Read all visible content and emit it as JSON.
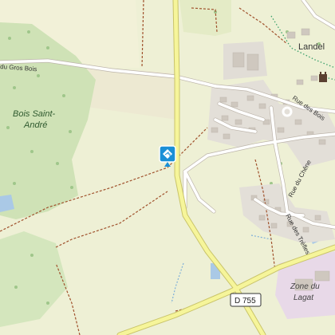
{
  "map": {
    "place_labels": {
      "wood": [
        "Bois Saint-",
        "André"
      ],
      "town": "Landel",
      "zone": [
        "Zone du",
        "Lagat"
      ]
    },
    "street_labels": {
      "gros_bois": "du Gros Bois",
      "rue_des_bois": "Rue des Bois",
      "rue_du_chene": "Rue du Chêne",
      "rue_des_trefles": "Rue des Trèfles"
    },
    "road_shield": "D 755",
    "marker": {
      "icon": "direction-diamond-icon",
      "color": "#1a8fd6"
    },
    "colors": {
      "background": "#eef0d5",
      "forest": "#cfe2b6",
      "forest_dark": "#bcd8a3",
      "main_road": "#f6f59a",
      "road_border": "#c9c46a",
      "minor_road": "#ffffff",
      "building": "#d9d4cd",
      "path": "#a0522d"
    }
  }
}
